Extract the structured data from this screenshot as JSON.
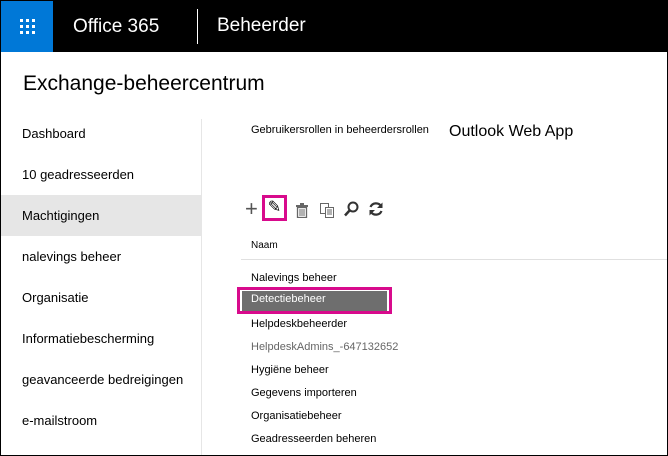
{
  "topbar": {
    "brand": "Office 365",
    "section": "Beheerder"
  },
  "app": {
    "title": "Exchange-beheercentrum"
  },
  "nav": {
    "items": [
      {
        "label": "Dashboard"
      },
      {
        "label": "10 geadresseerden"
      },
      {
        "label": "Machtigingen"
      },
      {
        "label": "nalevings beheer"
      },
      {
        "label": "Organisatie"
      },
      {
        "label": "Informatiebescherming"
      },
      {
        "label": "geavanceerde bedreigingen"
      },
      {
        "label": "e-mailstroom"
      }
    ],
    "active_index": 2
  },
  "tabs": {
    "admin_roles": "Gebruikersrollen in beheerdersrollen",
    "owa": "Outlook Web App"
  },
  "toolbar": {
    "add_symbol": "+",
    "edit_symbol": "✎"
  },
  "table": {
    "column_header": "Naam",
    "rows": [
      "Nalevings beheer",
      "Detectiebeheer",
      "Helpdeskbeheerder",
      "HelpdeskAdmins_-647132652",
      "Hygiëne beheer",
      "Gegevens importeren",
      "Organisatiebeheer",
      "Geadresseerden beheren"
    ],
    "selected_index": 1
  },
  "colors": {
    "topbar_bg": "#000000",
    "waffle_bg": "#0078d7",
    "highlight": "#d80a8c",
    "selected_row_bg": "#6e6e6e",
    "active_nav_bg": "#e6e6e6"
  }
}
